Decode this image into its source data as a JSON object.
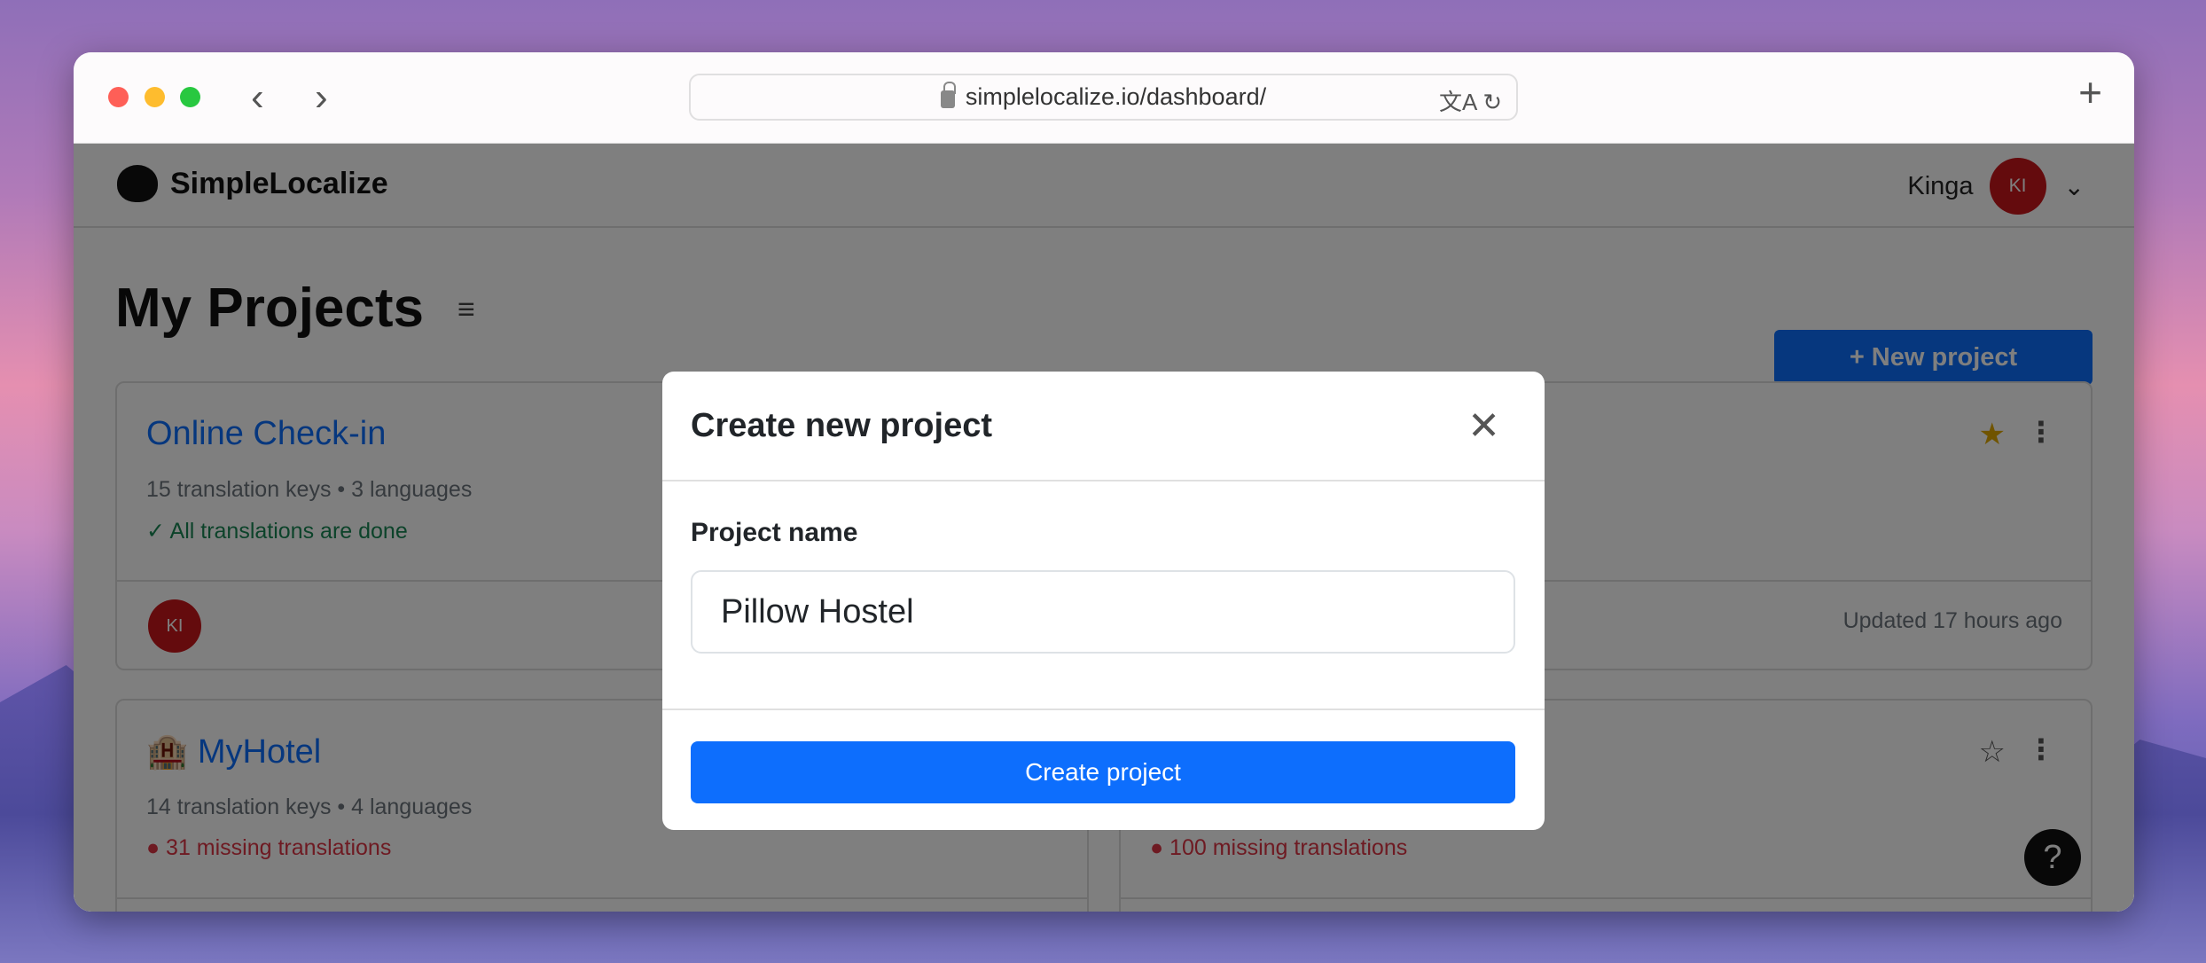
{
  "browser": {
    "url": "simplelocalize.io/dashboard/",
    "back": "‹",
    "forward": "›",
    "new_tab": "+",
    "translate_icon": "文A",
    "reload_icon": "↻"
  },
  "header": {
    "brand": "SimpleLocalize",
    "user_name": "Kinga",
    "user_initials": "KI"
  },
  "page": {
    "title": "My Projects",
    "new_project_label": "+  New project"
  },
  "projects": [
    {
      "name": "Online Check-in",
      "meta": "15 translation keys • 3 languages",
      "status": "All translations are done",
      "status_type": "done",
      "owner_initials": "KI",
      "updated": "Updated 17 hours ago",
      "starred": true
    },
    {
      "name": "🏨 MyHotel",
      "meta": "14 translation keys • 4 languages",
      "status": "31 missing translations",
      "status_type": "missing",
      "starred": false
    },
    {
      "status": "100 missing translations",
      "status_type": "missing",
      "starred": false
    }
  ],
  "modal": {
    "title": "Create new project",
    "field_label": "Project name",
    "field_value": "Pillow Hostel",
    "submit_label": "Create project"
  },
  "help_label": "?",
  "colors": {
    "primary": "#0d6efd",
    "avatar": "#c8161b",
    "success": "#198754",
    "danger": "#dc3545",
    "star": "#e0a800"
  }
}
